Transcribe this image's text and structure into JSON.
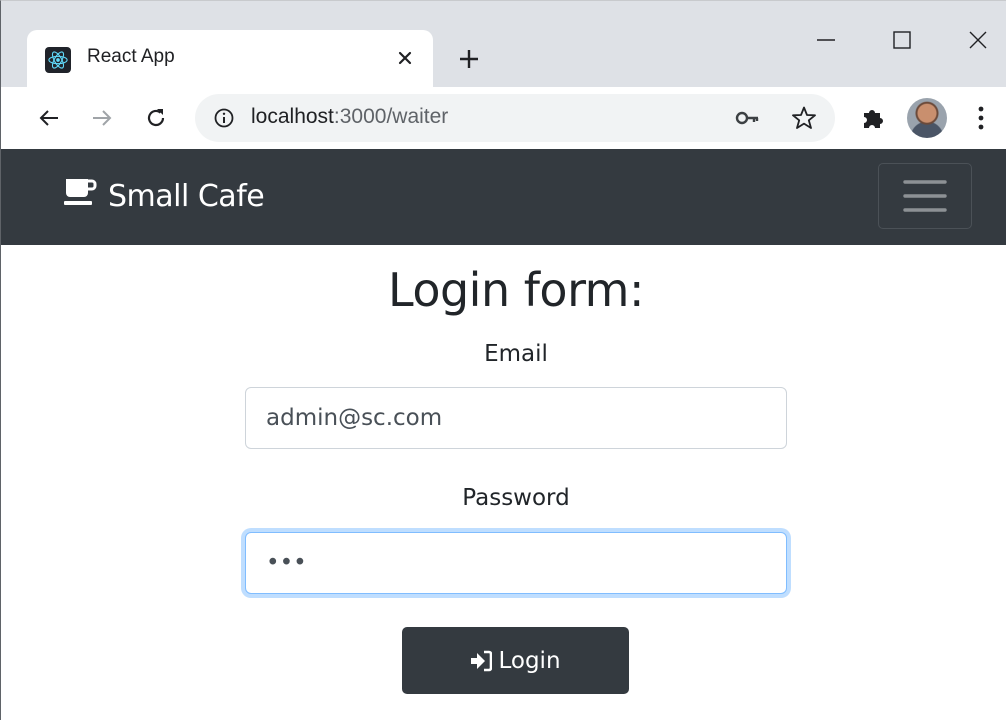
{
  "browser": {
    "tab_title": "React App",
    "url_host": "localhost",
    "url_rest": ":3000/waiter"
  },
  "navbar": {
    "brand": "Small Cafe",
    "brand_icon": "coffee-icon",
    "toggler_icon": "hamburger-icon"
  },
  "form": {
    "title": "Login form:",
    "email_label": "Email",
    "email_value": "admin@sc.com",
    "password_label": "Password",
    "password_value": "abc",
    "login_label": "Login",
    "login_icon": "sign-in-icon"
  },
  "colors": {
    "navbar_bg": "#343a40",
    "button_bg": "#343a40",
    "focus_ring": "#80bdff"
  }
}
